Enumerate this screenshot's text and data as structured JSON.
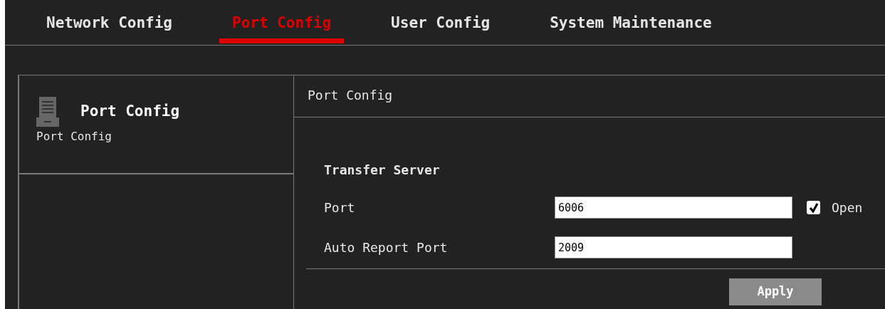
{
  "tabs": [
    {
      "label": "Network Config",
      "selected": false
    },
    {
      "label": "Port Config",
      "selected": true
    },
    {
      "label": "User Config",
      "selected": false
    },
    {
      "label": "System Maintenance",
      "selected": false
    }
  ],
  "sidebar": {
    "title": "Port Config",
    "items": [
      {
        "label": "Port Config"
      }
    ]
  },
  "panel": {
    "title": "Port Config",
    "section": "Transfer Server",
    "fields": [
      {
        "label": "Port",
        "value": "6006",
        "checkbox": {
          "label": "Open",
          "checked": true
        }
      },
      {
        "label": "Auto Report Port",
        "value": "2009"
      }
    ],
    "button": "Apply"
  }
}
